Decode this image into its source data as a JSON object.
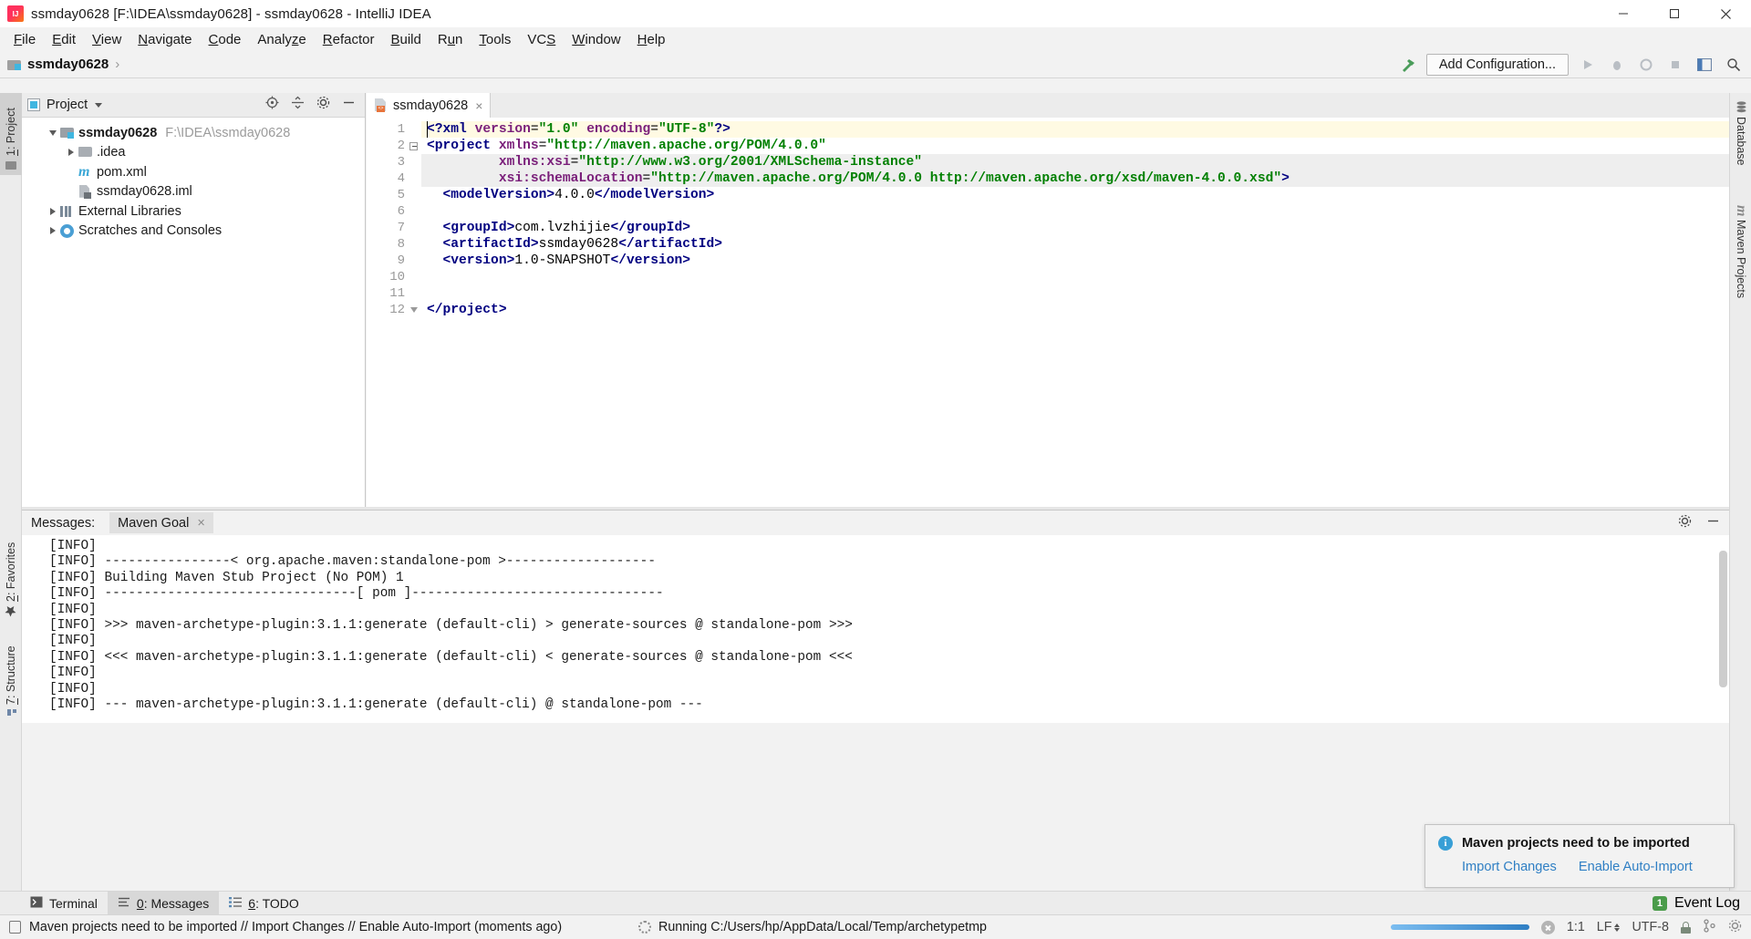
{
  "window": {
    "title": "ssmday0628 [F:\\IDEA\\ssmday0628] - ssmday0628 - IntelliJ IDEA",
    "app_icon": "intellij-idea-icon",
    "minimize": "minimize-icon",
    "maximize": "maximize-icon",
    "close": "close-icon"
  },
  "menubar": {
    "items": [
      {
        "label": "File",
        "mnemonic": "F"
      },
      {
        "label": "Edit",
        "mnemonic": "E"
      },
      {
        "label": "View",
        "mnemonic": "V"
      },
      {
        "label": "Navigate",
        "mnemonic": "N"
      },
      {
        "label": "Code",
        "mnemonic": "C"
      },
      {
        "label": "Analyze",
        "mnemonic": "z"
      },
      {
        "label": "Refactor",
        "mnemonic": "R"
      },
      {
        "label": "Build",
        "mnemonic": "B"
      },
      {
        "label": "Run",
        "mnemonic": "u"
      },
      {
        "label": "Tools",
        "mnemonic": "T"
      },
      {
        "label": "VCS",
        "mnemonic": "S"
      },
      {
        "label": "Window",
        "mnemonic": "W"
      },
      {
        "label": "Help",
        "mnemonic": "H"
      }
    ]
  },
  "navbar": {
    "breadcrumb": "ssmday0628",
    "separator": "›",
    "build_icon": "hammer-icon",
    "add_configuration": "Add Configuration...",
    "run_icon": "run-icon",
    "debug_icon": "debug-icon",
    "coverage_icon": "run-with-coverage-icon",
    "stop_icon": "stop-icon",
    "layout_icon": "layout-icon",
    "search_icon": "search-everywhere-icon"
  },
  "left_strip": {
    "project": "1: Project",
    "project_mnemonic": "1",
    "favorites": "2: Favorites",
    "favorites_mnemonic": "2",
    "structure": "7: Structure",
    "structure_mnemonic": "7"
  },
  "right_strip": {
    "database": "Database",
    "maven_projects": "Maven Projects"
  },
  "project_panel": {
    "title": "Project",
    "locate_icon": "locate-file-icon",
    "collapse_icon": "collapse-all-icon",
    "settings_icon": "gear-icon",
    "hide_icon": "hide-icon",
    "tree": [
      {
        "label": "ssmday0628",
        "path": "F:\\IDEA\\ssmday0628",
        "icon": "module-folder-icon",
        "indent": 0,
        "expanded": true,
        "bold": true
      },
      {
        "label": ".idea",
        "path": "",
        "icon": "folder-icon",
        "indent": 1,
        "expanded": false,
        "bold": false
      },
      {
        "label": "pom.xml",
        "path": "",
        "icon": "maven-file-icon",
        "indent": 1,
        "expanded": null,
        "bold": false
      },
      {
        "label": "ssmday0628.iml",
        "path": "",
        "icon": "iml-file-icon",
        "indent": 1,
        "expanded": null,
        "bold": false
      },
      {
        "label": "External Libraries",
        "path": "",
        "icon": "library-icon",
        "indent": 0,
        "expanded": false,
        "bold": false
      },
      {
        "label": "Scratches and Consoles",
        "path": "",
        "icon": "scratches-icon",
        "indent": 0,
        "expanded": false,
        "bold": false
      }
    ]
  },
  "editor": {
    "tab": {
      "label": "ssmday0628",
      "icon": "xml-file-icon",
      "close": "×"
    },
    "eye_icon": "preview-eye-icon",
    "lines": [
      {
        "n": 1,
        "fold": "",
        "highlight": "#fffae3",
        "segments": [
          {
            "t": "<?",
            "c": "tag"
          },
          {
            "t": "xml",
            "c": "tag"
          },
          {
            "t": " ",
            "c": "txt"
          },
          {
            "t": "version",
            "c": "attr"
          },
          {
            "t": "=",
            "c": "txt"
          },
          {
            "t": "\"1.0\"",
            "c": "val"
          },
          {
            "t": " ",
            "c": "txt"
          },
          {
            "t": "encoding",
            "c": "attr"
          },
          {
            "t": "=",
            "c": "txt"
          },
          {
            "t": "\"UTF-8\"",
            "c": "val"
          },
          {
            "t": "?>",
            "c": "tag"
          }
        ]
      },
      {
        "n": 2,
        "fold": "minus",
        "highlight": "",
        "segments": [
          {
            "t": "<project",
            "c": "tag"
          },
          {
            "t": " ",
            "c": "txt"
          },
          {
            "t": "xmlns",
            "c": "attr"
          },
          {
            "t": "=",
            "c": "txt"
          },
          {
            "t": "\"http://maven.apache.org/POM/4.0.0\"",
            "c": "val"
          }
        ]
      },
      {
        "n": 3,
        "fold": "",
        "highlight": "#eeeeee",
        "segments": [
          {
            "t": "         ",
            "c": "txt"
          },
          {
            "t": "xmlns:xsi",
            "c": "attr"
          },
          {
            "t": "=",
            "c": "txt"
          },
          {
            "t": "\"http://www.w3.org/2001/XMLSchema-instance\"",
            "c": "val"
          }
        ]
      },
      {
        "n": 4,
        "fold": "",
        "highlight": "#eeeeee",
        "segments": [
          {
            "t": "         ",
            "c": "txt"
          },
          {
            "t": "xsi:schemaLocation",
            "c": "attr"
          },
          {
            "t": "=",
            "c": "txt"
          },
          {
            "t": "\"http://maven.apache.org/POM/4.0.0 http://maven.apache.org/xsd/maven-4.0.0.xsd\"",
            "c": "val"
          },
          {
            "t": ">",
            "c": "tag"
          }
        ]
      },
      {
        "n": 5,
        "fold": "",
        "highlight": "",
        "segments": [
          {
            "t": "  ",
            "c": "txt"
          },
          {
            "t": "<modelVersion>",
            "c": "tag"
          },
          {
            "t": "4.0.0",
            "c": "txt"
          },
          {
            "t": "</modelVersion>",
            "c": "tag"
          }
        ]
      },
      {
        "n": 6,
        "fold": "",
        "highlight": "",
        "segments": []
      },
      {
        "n": 7,
        "fold": "",
        "highlight": "",
        "segments": [
          {
            "t": "  ",
            "c": "txt"
          },
          {
            "t": "<groupId>",
            "c": "tag"
          },
          {
            "t": "com.lvzhijie",
            "c": "txt"
          },
          {
            "t": "</groupId>",
            "c": "tag"
          }
        ]
      },
      {
        "n": 8,
        "fold": "",
        "highlight": "",
        "segments": [
          {
            "t": "  ",
            "c": "txt"
          },
          {
            "t": "<artifactId>",
            "c": "tag"
          },
          {
            "t": "ssmday0628",
            "c": "txt"
          },
          {
            "t": "</artifactId>",
            "c": "tag"
          }
        ]
      },
      {
        "n": 9,
        "fold": "",
        "highlight": "",
        "segments": [
          {
            "t": "  ",
            "c": "txt"
          },
          {
            "t": "<version>",
            "c": "tag"
          },
          {
            "t": "1.0-SNAPSHOT",
            "c": "txt"
          },
          {
            "t": "</version>",
            "c": "tag"
          }
        ]
      },
      {
        "n": 10,
        "fold": "",
        "highlight": "",
        "segments": []
      },
      {
        "n": 11,
        "fold": "",
        "highlight": "",
        "segments": []
      },
      {
        "n": 12,
        "fold": "tri",
        "highlight": "",
        "segments": [
          {
            "t": "</project>",
            "c": "tag"
          }
        ]
      }
    ]
  },
  "messages": {
    "label": "Messages:",
    "tab": "Maven Goal",
    "tab_close": "×",
    "settings_icon": "gear-icon",
    "hide_icon": "hide-icon",
    "console_lines": [
      "[INFO]",
      "[INFO] ----------------< org.apache.maven:standalone-pom >-------------------",
      "[INFO] Building Maven Stub Project (No POM) 1",
      "[INFO] --------------------------------[ pom ]--------------------------------",
      "[INFO]",
      "[INFO] >>> maven-archetype-plugin:3.1.1:generate (default-cli) > generate-sources @ standalone-pom >>>",
      "[INFO]",
      "[INFO] <<< maven-archetype-plugin:3.1.1:generate (default-cli) < generate-sources @ standalone-pom <<<",
      "[INFO]",
      "[INFO]",
      "[INFO] --- maven-archetype-plugin:3.1.1:generate (default-cli) @ standalone-pom ---"
    ]
  },
  "balloon": {
    "icon": "info-icon",
    "title": "Maven projects need to be imported",
    "link_import": "Import Changes",
    "link_auto": "Enable Auto-Import"
  },
  "bottom_tabs": {
    "terminal": {
      "label": "Terminal",
      "icon": "terminal-icon"
    },
    "messages": {
      "label": "0: Messages",
      "mnemonic": "0",
      "icon": "messages-icon"
    },
    "todo": {
      "label": "6: TODO",
      "mnemonic": "6",
      "icon": "todo-icon"
    },
    "event_log": {
      "label": "Event Log",
      "count": "1"
    }
  },
  "statusbar": {
    "message": "Maven projects need to be imported // Import Changes // Enable Auto-Import (moments ago)",
    "message_icon": "balloon-icon",
    "running": "Running C:/Users/hp/AppData/Local/Temp/archetypetmp",
    "running_icon": "spinner-icon",
    "stop_icon": "stop-process-icon",
    "caret_position": "1:1",
    "line_separator": "LF",
    "encoding": "UTF-8",
    "lock_icon": "read-only-lock-icon",
    "branch_icon": "vcs-branch-icon",
    "settings_icon": "gear-icon"
  },
  "colors": {
    "accent": "#2f7fc4",
    "tag": "#000080",
    "attr": "#7a1f7a",
    "value": "#008000",
    "chrome": "#f2f2f2",
    "highlight_line": "#fffae3"
  }
}
